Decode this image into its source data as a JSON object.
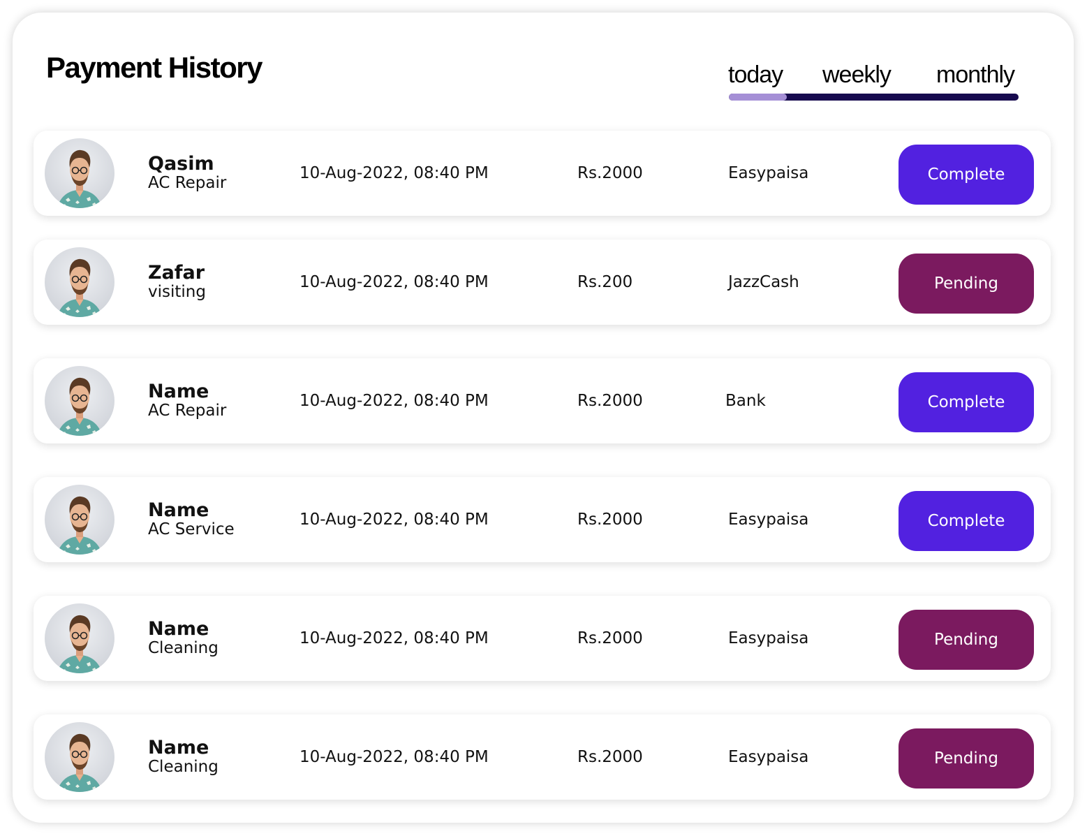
{
  "header": {
    "title": "Payment History",
    "tabs": [
      {
        "label": "today",
        "active": true
      },
      {
        "label": "weekly",
        "active": false
      },
      {
        "label": "monthly",
        "active": false
      }
    ],
    "tab_indicator_fraction": 0.2
  },
  "colors": {
    "complete": "#5221e0",
    "pending": "#7b1a5f",
    "track": "#170a4f",
    "track_active": "#a58fd6"
  },
  "rows": [
    {
      "name": "Qasim",
      "service": "AC Repair",
      "datetime": "10-Aug-2022, 08:40 PM",
      "amount": "Rs.2000",
      "method": "Easypaisa",
      "status": "Complete"
    },
    {
      "name": "Zafar",
      "service": "visiting",
      "datetime": "10-Aug-2022, 08:40 PM",
      "amount": "Rs.200",
      "method": "JazzCash",
      "status": "Pending"
    },
    {
      "name": "Name",
      "service": "AC Repair",
      "datetime": "10-Aug-2022, 08:40 PM",
      "amount": "Rs.2000",
      "method": "Bank",
      "status": "Complete"
    },
    {
      "name": "Name",
      "service": "AC Service",
      "datetime": "10-Aug-2022, 08:40 PM",
      "amount": "Rs.2000",
      "method": "Easypaisa",
      "status": "Complete"
    },
    {
      "name": "Name",
      "service": "Cleaning",
      "datetime": "10-Aug-2022, 08:40 PM",
      "amount": "Rs.2000",
      "method": "Easypaisa",
      "status": "Pending"
    },
    {
      "name": "Name",
      "service": "Cleaning",
      "datetime": "10-Aug-2022, 08:40 PM",
      "amount": "Rs.2000",
      "method": "Easypaisa",
      "status": "Pending"
    }
  ]
}
